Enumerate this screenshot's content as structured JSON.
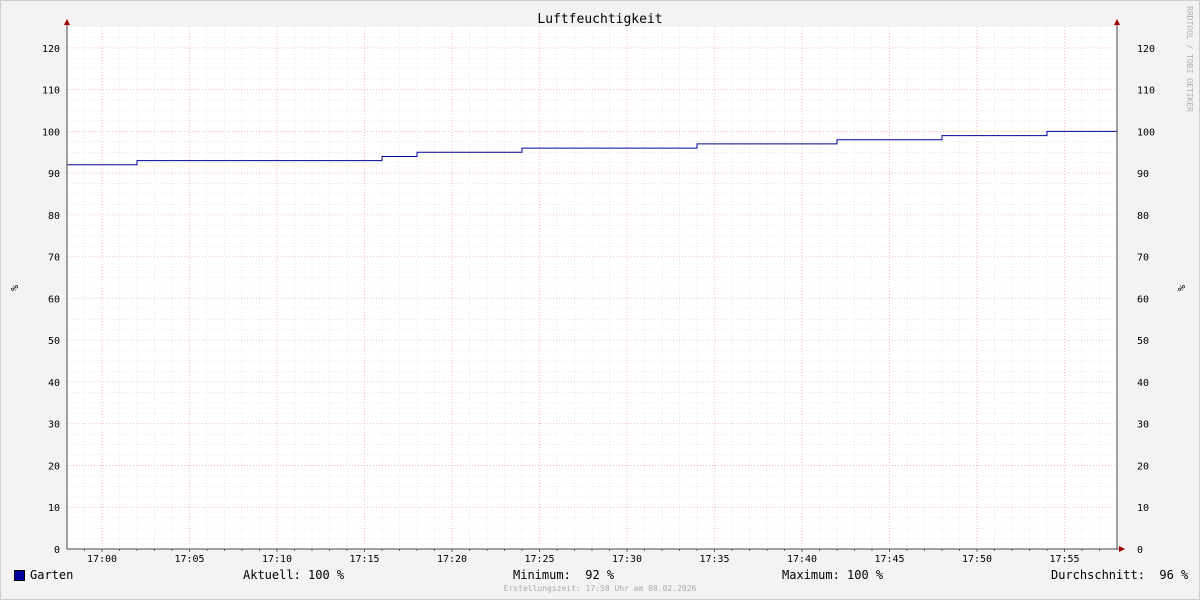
{
  "chart_data": {
    "type": "line",
    "title": "Luftfeuchtigkeit",
    "ylabel": "%",
    "ylim": [
      0,
      125
    ],
    "xlim_minutes": [
      "16:58",
      "17:58"
    ],
    "y_ticks": [
      "0",
      "10",
      "20",
      "30",
      "40",
      "50",
      "60",
      "70",
      "80",
      "90",
      "100",
      "110",
      "120"
    ],
    "x_ticks": [
      "17:00",
      "17:05",
      "17:10",
      "17:15",
      "17:20",
      "17:25",
      "17:30",
      "17:35",
      "17:40",
      "17:45",
      "17:50",
      "17:55"
    ],
    "grid": true,
    "watermark": "RRDTOOL / TOBI OETIKER",
    "series": [
      {
        "name": "Garten",
        "color": "#00009c",
        "step": true,
        "points": [
          {
            "x": "16:58",
            "y": 92
          },
          {
            "x": "17:02",
            "y": 93
          },
          {
            "x": "17:16",
            "y": 94
          },
          {
            "x": "17:18",
            "y": 95
          },
          {
            "x": "17:24",
            "y": 96
          },
          {
            "x": "17:34",
            "y": 97
          },
          {
            "x": "17:42",
            "y": 98
          },
          {
            "x": "17:48",
            "y": 99
          },
          {
            "x": "17:54",
            "y": 100
          },
          {
            "x": "17:58",
            "y": 100
          }
        ]
      }
    ]
  },
  "legend": {
    "series_name": "Garten",
    "current": "Aktuell: 100 %",
    "minimum": "Minimum:  92 %",
    "maximum": "Maximum: 100 %",
    "average": "Durchschnitt:  96 %"
  },
  "footer": "Erstellungszeit: 17:58 Uhr am 08.02.2026"
}
